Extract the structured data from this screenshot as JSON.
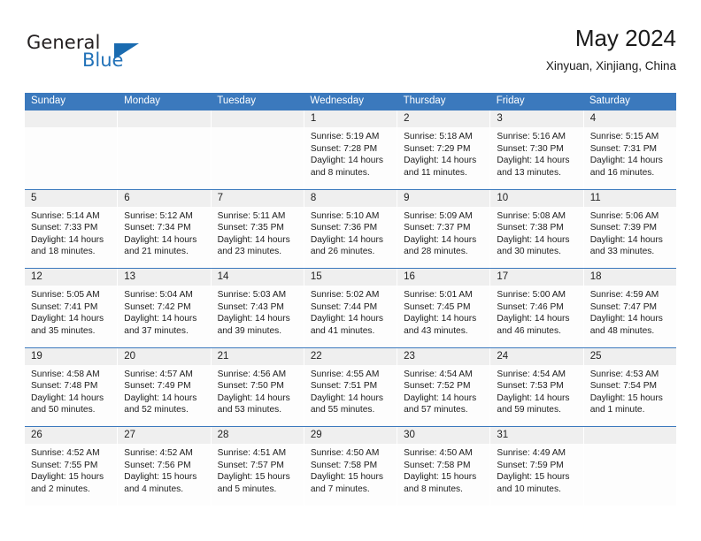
{
  "brand": {
    "name_top": "General",
    "name_bottom": "Blue",
    "triangle_color": "#1a6bb0",
    "blue_color": "#2272b8"
  },
  "header": {
    "month_title": "May 2024",
    "location": "Xinyuan, Xinjiang, China"
  },
  "theme": {
    "header_bg": "#3b79bd",
    "day_band_bg": "#efefef",
    "cell_bg": "#fdfdfd"
  },
  "weekdays": [
    "Sunday",
    "Monday",
    "Tuesday",
    "Wednesday",
    "Thursday",
    "Friday",
    "Saturday"
  ],
  "weeks": [
    [
      {
        "day": "",
        "sunrise": "",
        "sunset": "",
        "daylight_line1": "",
        "daylight_line2": ""
      },
      {
        "day": "",
        "sunrise": "",
        "sunset": "",
        "daylight_line1": "",
        "daylight_line2": ""
      },
      {
        "day": "",
        "sunrise": "",
        "sunset": "",
        "daylight_line1": "",
        "daylight_line2": ""
      },
      {
        "day": "1",
        "sunrise": "Sunrise: 5:19 AM",
        "sunset": "Sunset: 7:28 PM",
        "daylight_line1": "Daylight: 14 hours",
        "daylight_line2": "and 8 minutes."
      },
      {
        "day": "2",
        "sunrise": "Sunrise: 5:18 AM",
        "sunset": "Sunset: 7:29 PM",
        "daylight_line1": "Daylight: 14 hours",
        "daylight_line2": "and 11 minutes."
      },
      {
        "day": "3",
        "sunrise": "Sunrise: 5:16 AM",
        "sunset": "Sunset: 7:30 PM",
        "daylight_line1": "Daylight: 14 hours",
        "daylight_line2": "and 13 minutes."
      },
      {
        "day": "4",
        "sunrise": "Sunrise: 5:15 AM",
        "sunset": "Sunset: 7:31 PM",
        "daylight_line1": "Daylight: 14 hours",
        "daylight_line2": "and 16 minutes."
      }
    ],
    [
      {
        "day": "5",
        "sunrise": "Sunrise: 5:14 AM",
        "sunset": "Sunset: 7:33 PM",
        "daylight_line1": "Daylight: 14 hours",
        "daylight_line2": "and 18 minutes."
      },
      {
        "day": "6",
        "sunrise": "Sunrise: 5:12 AM",
        "sunset": "Sunset: 7:34 PM",
        "daylight_line1": "Daylight: 14 hours",
        "daylight_line2": "and 21 minutes."
      },
      {
        "day": "7",
        "sunrise": "Sunrise: 5:11 AM",
        "sunset": "Sunset: 7:35 PM",
        "daylight_line1": "Daylight: 14 hours",
        "daylight_line2": "and 23 minutes."
      },
      {
        "day": "8",
        "sunrise": "Sunrise: 5:10 AM",
        "sunset": "Sunset: 7:36 PM",
        "daylight_line1": "Daylight: 14 hours",
        "daylight_line2": "and 26 minutes."
      },
      {
        "day": "9",
        "sunrise": "Sunrise: 5:09 AM",
        "sunset": "Sunset: 7:37 PM",
        "daylight_line1": "Daylight: 14 hours",
        "daylight_line2": "and 28 minutes."
      },
      {
        "day": "10",
        "sunrise": "Sunrise: 5:08 AM",
        "sunset": "Sunset: 7:38 PM",
        "daylight_line1": "Daylight: 14 hours",
        "daylight_line2": "and 30 minutes."
      },
      {
        "day": "11",
        "sunrise": "Sunrise: 5:06 AM",
        "sunset": "Sunset: 7:39 PM",
        "daylight_line1": "Daylight: 14 hours",
        "daylight_line2": "and 33 minutes."
      }
    ],
    [
      {
        "day": "12",
        "sunrise": "Sunrise: 5:05 AM",
        "sunset": "Sunset: 7:41 PM",
        "daylight_line1": "Daylight: 14 hours",
        "daylight_line2": "and 35 minutes."
      },
      {
        "day": "13",
        "sunrise": "Sunrise: 5:04 AM",
        "sunset": "Sunset: 7:42 PM",
        "daylight_line1": "Daylight: 14 hours",
        "daylight_line2": "and 37 minutes."
      },
      {
        "day": "14",
        "sunrise": "Sunrise: 5:03 AM",
        "sunset": "Sunset: 7:43 PM",
        "daylight_line1": "Daylight: 14 hours",
        "daylight_line2": "and 39 minutes."
      },
      {
        "day": "15",
        "sunrise": "Sunrise: 5:02 AM",
        "sunset": "Sunset: 7:44 PM",
        "daylight_line1": "Daylight: 14 hours",
        "daylight_line2": "and 41 minutes."
      },
      {
        "day": "16",
        "sunrise": "Sunrise: 5:01 AM",
        "sunset": "Sunset: 7:45 PM",
        "daylight_line1": "Daylight: 14 hours",
        "daylight_line2": "and 43 minutes."
      },
      {
        "day": "17",
        "sunrise": "Sunrise: 5:00 AM",
        "sunset": "Sunset: 7:46 PM",
        "daylight_line1": "Daylight: 14 hours",
        "daylight_line2": "and 46 minutes."
      },
      {
        "day": "18",
        "sunrise": "Sunrise: 4:59 AM",
        "sunset": "Sunset: 7:47 PM",
        "daylight_line1": "Daylight: 14 hours",
        "daylight_line2": "and 48 minutes."
      }
    ],
    [
      {
        "day": "19",
        "sunrise": "Sunrise: 4:58 AM",
        "sunset": "Sunset: 7:48 PM",
        "daylight_line1": "Daylight: 14 hours",
        "daylight_line2": "and 50 minutes."
      },
      {
        "day": "20",
        "sunrise": "Sunrise: 4:57 AM",
        "sunset": "Sunset: 7:49 PM",
        "daylight_line1": "Daylight: 14 hours",
        "daylight_line2": "and 52 minutes."
      },
      {
        "day": "21",
        "sunrise": "Sunrise: 4:56 AM",
        "sunset": "Sunset: 7:50 PM",
        "daylight_line1": "Daylight: 14 hours",
        "daylight_line2": "and 53 minutes."
      },
      {
        "day": "22",
        "sunrise": "Sunrise: 4:55 AM",
        "sunset": "Sunset: 7:51 PM",
        "daylight_line1": "Daylight: 14 hours",
        "daylight_line2": "and 55 minutes."
      },
      {
        "day": "23",
        "sunrise": "Sunrise: 4:54 AM",
        "sunset": "Sunset: 7:52 PM",
        "daylight_line1": "Daylight: 14 hours",
        "daylight_line2": "and 57 minutes."
      },
      {
        "day": "24",
        "sunrise": "Sunrise: 4:54 AM",
        "sunset": "Sunset: 7:53 PM",
        "daylight_line1": "Daylight: 14 hours",
        "daylight_line2": "and 59 minutes."
      },
      {
        "day": "25",
        "sunrise": "Sunrise: 4:53 AM",
        "sunset": "Sunset: 7:54 PM",
        "daylight_line1": "Daylight: 15 hours",
        "daylight_line2": "and 1 minute."
      }
    ],
    [
      {
        "day": "26",
        "sunrise": "Sunrise: 4:52 AM",
        "sunset": "Sunset: 7:55 PM",
        "daylight_line1": "Daylight: 15 hours",
        "daylight_line2": "and 2 minutes."
      },
      {
        "day": "27",
        "sunrise": "Sunrise: 4:52 AM",
        "sunset": "Sunset: 7:56 PM",
        "daylight_line1": "Daylight: 15 hours",
        "daylight_line2": "and 4 minutes."
      },
      {
        "day": "28",
        "sunrise": "Sunrise: 4:51 AM",
        "sunset": "Sunset: 7:57 PM",
        "daylight_line1": "Daylight: 15 hours",
        "daylight_line2": "and 5 minutes."
      },
      {
        "day": "29",
        "sunrise": "Sunrise: 4:50 AM",
        "sunset": "Sunset: 7:58 PM",
        "daylight_line1": "Daylight: 15 hours",
        "daylight_line2": "and 7 minutes."
      },
      {
        "day": "30",
        "sunrise": "Sunrise: 4:50 AM",
        "sunset": "Sunset: 7:58 PM",
        "daylight_line1": "Daylight: 15 hours",
        "daylight_line2": "and 8 minutes."
      },
      {
        "day": "31",
        "sunrise": "Sunrise: 4:49 AM",
        "sunset": "Sunset: 7:59 PM",
        "daylight_line1": "Daylight: 15 hours",
        "daylight_line2": "and 10 minutes."
      },
      {
        "day": "",
        "sunrise": "",
        "sunset": "",
        "daylight_line1": "",
        "daylight_line2": ""
      }
    ]
  ]
}
